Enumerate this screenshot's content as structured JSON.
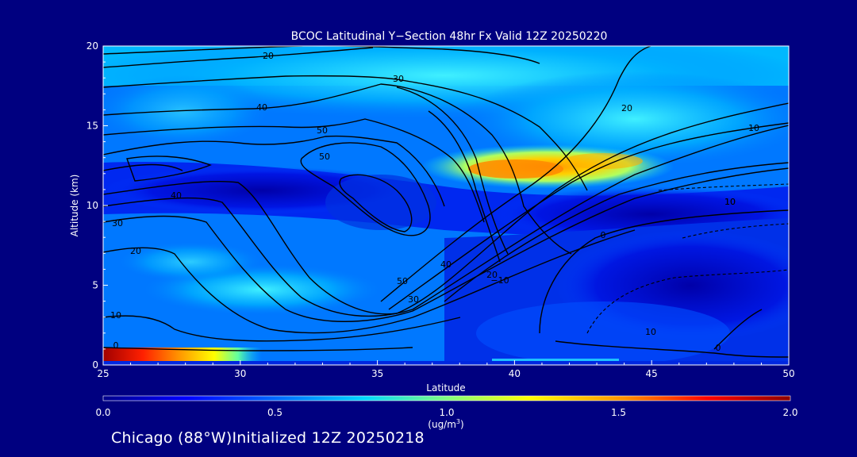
{
  "chart_data": {
    "type": "heatmap",
    "title": "BCOC Latitudinal Y−Section 48hr  Fx Valid 12Z 20250220",
    "xlabel": "Latitude",
    "ylabel": "Altitude (km)",
    "xlim": [
      25,
      50
    ],
    "ylim": [
      0,
      20
    ],
    "x_ticks": [
      "25",
      "30",
      "35",
      "40",
      "45",
      "50"
    ],
    "y_ticks": [
      "0",
      "5",
      "10",
      "15",
      "20"
    ],
    "colorbar": {
      "range": [
        0.0,
        2.0
      ],
      "tick_labels": [
        "0.0",
        "0.5",
        "1.0",
        "1.5",
        "2.0"
      ],
      "unit_line1": "(ug/m",
      "unit_sup": "3",
      "unit_line2": ")",
      "colors": [
        "#00008b",
        "#0000ff",
        "#0078ff",
        "#00e0ff",
        "#80ff80",
        "#ffff00",
        "#ff9000",
        "#ff0000",
        "#8b0000"
      ]
    },
    "contour_labels": [
      "20",
      "30",
      "40",
      "50",
      "50",
      "40",
      "30",
      "20",
      "10",
      "0",
      "−10",
      "0",
      "10",
      "20",
      "50",
      "40",
      "30",
      "20",
      "10",
      "10",
      "10",
      "0"
    ]
  },
  "footer": "Chicago (88°W)Initialized 12Z 20250218"
}
